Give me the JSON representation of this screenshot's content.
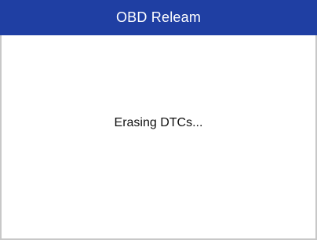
{
  "window": {
    "title": "OBD Releam"
  },
  "main": {
    "status_message": "Erasing DTCs..."
  },
  "colors": {
    "title_bar_background": "#1f3fa3",
    "title_text": "#ffffff",
    "content_background": "#ffffff",
    "message_text": "#111111"
  }
}
